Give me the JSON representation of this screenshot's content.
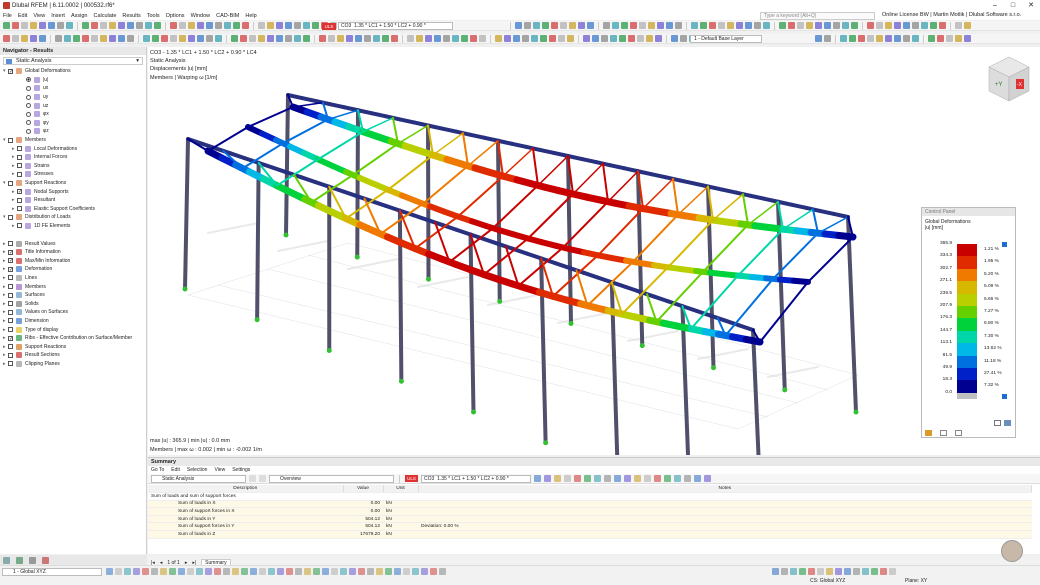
{
  "app": {
    "title": "Dlubal RFEM | 6.11.0002 | 000532.rf6*",
    "search_placeholder": "Type a keyword (Alt+Q)",
    "license": "Online License BW | Martin Motlik | Dlubal Software s.r.o."
  },
  "menu": [
    "File",
    "Edit",
    "View",
    "Insert",
    "Assign",
    "Calculate",
    "Results",
    "Tools",
    "Options",
    "Window",
    "CAD-BIM",
    "Help"
  ],
  "toolbar": {
    "combo": "CO3",
    "combo_expr": "1.35 * LC1 + 1.50 * LC2 + 0.90 *",
    "layer": "1 - Default Base Layer",
    "combo_tag": "ULS"
  },
  "navigator": {
    "title": "Navigator - Results",
    "analysis": "Static Analysis",
    "tree": [
      {
        "label": "Global Deformations",
        "level": 0,
        "type": "check",
        "checked": true,
        "open": true
      },
      {
        "label": "|u|",
        "level": 2,
        "type": "radio",
        "checked": true
      },
      {
        "label": "ux",
        "level": 2,
        "type": "radio"
      },
      {
        "label": "uy",
        "level": 2,
        "type": "radio"
      },
      {
        "label": "uz",
        "level": 2,
        "type": "radio"
      },
      {
        "label": "φx",
        "level": 2,
        "type": "radio"
      },
      {
        "label": "φy",
        "level": 2,
        "type": "radio"
      },
      {
        "label": "φz",
        "level": 2,
        "type": "radio"
      },
      {
        "label": "Members",
        "level": 0,
        "type": "check",
        "open": true
      },
      {
        "label": "Local Deformations",
        "level": 1,
        "type": "check"
      },
      {
        "label": "Internal Forces",
        "level": 1,
        "type": "check"
      },
      {
        "label": "Strains",
        "level": 1,
        "type": "check"
      },
      {
        "label": "Stresses",
        "level": 1,
        "type": "check"
      },
      {
        "label": "Support Reactions",
        "level": 0,
        "type": "check",
        "open": true
      },
      {
        "label": "Nodal Supports",
        "level": 1,
        "type": "check",
        "checked": true
      },
      {
        "label": "Resultant",
        "level": 1,
        "type": "check"
      },
      {
        "label": "Elastic Support Coefficients",
        "level": 1,
        "type": "check"
      },
      {
        "label": "Distribution of Loads",
        "level": 0,
        "type": "check",
        "open": true
      },
      {
        "label": "1D FE Elements",
        "level": 1,
        "type": "check"
      }
    ],
    "options": [
      {
        "label": "Result Values",
        "checked": false
      },
      {
        "label": "Title Information",
        "checked": true
      },
      {
        "label": "Max/Min Information",
        "checked": true
      },
      {
        "label": "Deformation",
        "checked": true
      },
      {
        "label": "Lines",
        "checked": false
      },
      {
        "label": "Members",
        "checked": false
      },
      {
        "label": "Surfaces",
        "checked": false
      },
      {
        "label": "Solids",
        "checked": false
      },
      {
        "label": "Values on Surfaces",
        "checked": false
      },
      {
        "label": "Dimension",
        "checked": false
      },
      {
        "label": "Type of display",
        "checked": false
      },
      {
        "label": "Ribs - Effective Contribution on Surface/Member",
        "checked": true
      },
      {
        "label": "Support Reactions",
        "checked": false
      },
      {
        "label": "Result Sections",
        "checked": false
      },
      {
        "label": "Clipping Planes",
        "checked": false
      }
    ]
  },
  "view": {
    "line1": "CO3 - 1.35 * LC1 + 1.50 * LC2 + 0.90 * LC4",
    "line2": "Static Analysis",
    "line3": "Displacements |u| [mm]",
    "line4": "Members | Warping ω [1/m]",
    "bottom1": "max |u| : 365.9 | min |u| : 0.0 mm",
    "bottom2": "Members | max ω : 0.002 | min ω : -0.002 1/m",
    "cube_y": "+Y",
    "cube_x": "-X"
  },
  "control_panel": {
    "title": "Control Panel",
    "section": "Global Deformations",
    "unit": "|u| [mm]",
    "legend": [
      {
        "value": "365.9",
        "color": "#c80000",
        "pct": "1.21 %"
      },
      {
        "value": "334.3",
        "color": "#e02a00",
        "pct": "1.95 %"
      },
      {
        "value": "302.7",
        "color": "#f07a00",
        "pct": "5.20 %"
      },
      {
        "value": "271.1",
        "color": "#d7b800",
        "pct": "5.09 %"
      },
      {
        "value": "239.5",
        "color": "#b9cf00",
        "pct": "5.66 %"
      },
      {
        "value": "207.9",
        "color": "#64d000",
        "pct": "7.27 %"
      },
      {
        "value": "176.3",
        "color": "#00d23c",
        "pct": "6.80 %"
      },
      {
        "value": "144.7",
        "color": "#00d6a8",
        "pct": "7.30 %"
      },
      {
        "value": "113.1",
        "color": "#00b8e8",
        "pct": "13.62 %"
      },
      {
        "value": "81.5",
        "color": "#0070e0",
        "pct": "11.18 %"
      },
      {
        "value": "49.9",
        "color": "#0020c8",
        "pct": "27.41 %"
      },
      {
        "value": "18.3",
        "color": "#000090",
        "pct": "7.32 %"
      },
      {
        "value": "0.0",
        "color": "#c0c0c0",
        "pct": ""
      }
    ]
  },
  "summary": {
    "title": "Summary",
    "menu": [
      "Go To",
      "Edit",
      "Selection",
      "View",
      "Settings"
    ],
    "analysis": "Static Analysis",
    "view": "Overview",
    "combo": "CO3",
    "combo_expr": "1.35 * LC1 + 1.50 * LC2 + 0.90 *",
    "combo_tag": "ULS",
    "columns": [
      "Description",
      "Value",
      "Unit",
      "Notes"
    ],
    "group": "Sum of loads and sum of support forces",
    "rows": [
      {
        "d": "Sum of loads in X",
        "v": "0.00",
        "u": "kN",
        "n": ""
      },
      {
        "d": "Sum of support forces in X",
        "v": "0.00",
        "u": "kN",
        "n": ""
      },
      {
        "d": "Sum of loads in Y",
        "v": "504.12",
        "u": "kN",
        "n": ""
      },
      {
        "d": "Sum of support forces in Y",
        "v": "504.12",
        "u": "kN",
        "n": "Deviation: 0.00 %"
      },
      {
        "d": "Sum of loads in Z",
        "v": "17679.20",
        "u": "kN",
        "n": ""
      }
    ],
    "pager": "1 of 1",
    "sheet": "Summary"
  },
  "status": {
    "cs_select": "1 - Global XYZ",
    "cs": "CS: Global XYZ",
    "plane": "Plane: XY"
  }
}
